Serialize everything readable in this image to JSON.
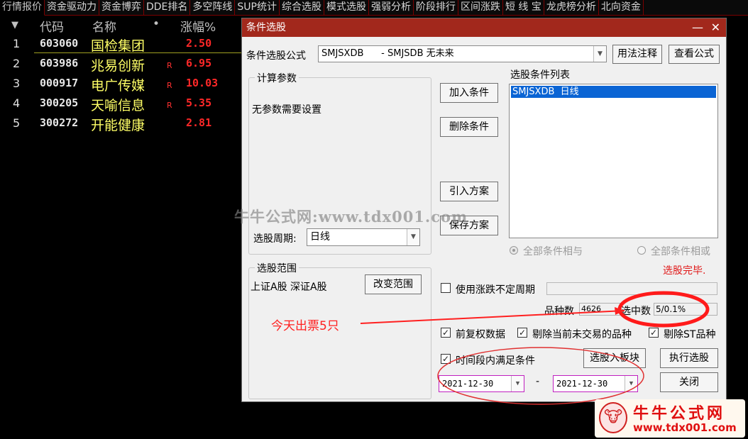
{
  "tabs": [
    "行情报价",
    "资金驱动力",
    "资金博弈",
    "DDE排名",
    "多空阵线",
    "SUP统计",
    "综合选股",
    "模式选股",
    "强弱分析",
    "阶段排行",
    "区间涨跌",
    "短 线 宝",
    "龙虎榜分析",
    "北向资金"
  ],
  "table": {
    "headers": {
      "arrow": "▼",
      "code": "代码",
      "name": "名称",
      "dot": "•",
      "pct": "涨幅%"
    },
    "rows": [
      {
        "n": "1",
        "code": "603060",
        "name": "国检集团",
        "flag": "",
        "pct": "2.50"
      },
      {
        "n": "2",
        "code": "603986",
        "name": "兆易创新",
        "flag": "R",
        "pct": "6.95"
      },
      {
        "n": "3",
        "code": "000917",
        "name": "电广传媒",
        "flag": "R",
        "pct": "10.03"
      },
      {
        "n": "4",
        "code": "300205",
        "name": "天喻信息",
        "flag": "R",
        "pct": "5.35"
      },
      {
        "n": "5",
        "code": "300272",
        "name": "开能健康",
        "flag": "",
        "pct": "2.81"
      }
    ]
  },
  "dialog": {
    "title": "条件选股",
    "min_glyph": "—",
    "close_glyph": "✕",
    "formula_label": "条件选股公式",
    "formula_value": "SMJSXDB      - SMJSDB 无未来",
    "btn_usage": "用法注释",
    "btn_view": "查看公式",
    "params_group": "计算参数",
    "params_text": "无参数需要设置",
    "btn_add": "加入条件",
    "btn_delete": "删除条件",
    "btn_import": "引入方案",
    "btn_save": "保存方案",
    "list_title": "选股条件列表",
    "list_item": "SMJSXDB  日线",
    "period_label": "选股周期:",
    "period_value": "日线",
    "radio_and": "全部条件相与",
    "radio_or": "全部条件相或",
    "status": "选股完毕.",
    "range_group": "选股范围",
    "range_text": "上证A股 深证A股",
    "btn_range": "改变范围",
    "chk_unfixed": "使用涨跌不定周期",
    "count_label": "品种数",
    "count_value": "4626",
    "hit_label": "选中数",
    "hit_value": "5/0.1%",
    "chk_restore": "前复权数据",
    "chk_exclude_untraded": "剔除当前未交易的品种",
    "chk_exclude_st": "剔除ST品种",
    "chk_timerange": "时间段内满足条件",
    "btn_to_block": "选股入板块",
    "btn_execute": "执行选股",
    "date_from": "2021-12-30",
    "date_sep": "-",
    "date_to": "2021-12-30",
    "btn_close": "关闭"
  },
  "overlay": {
    "watermark": "牛牛公式网:www.tdx001.com",
    "annotation": "今天出票5只",
    "logo_title": "牛牛公式网",
    "logo_url": "www.tdx001.com"
  },
  "colors": {
    "accent": "#a2281c",
    "annot": "#ff2020",
    "selected": "#0a64d4"
  }
}
